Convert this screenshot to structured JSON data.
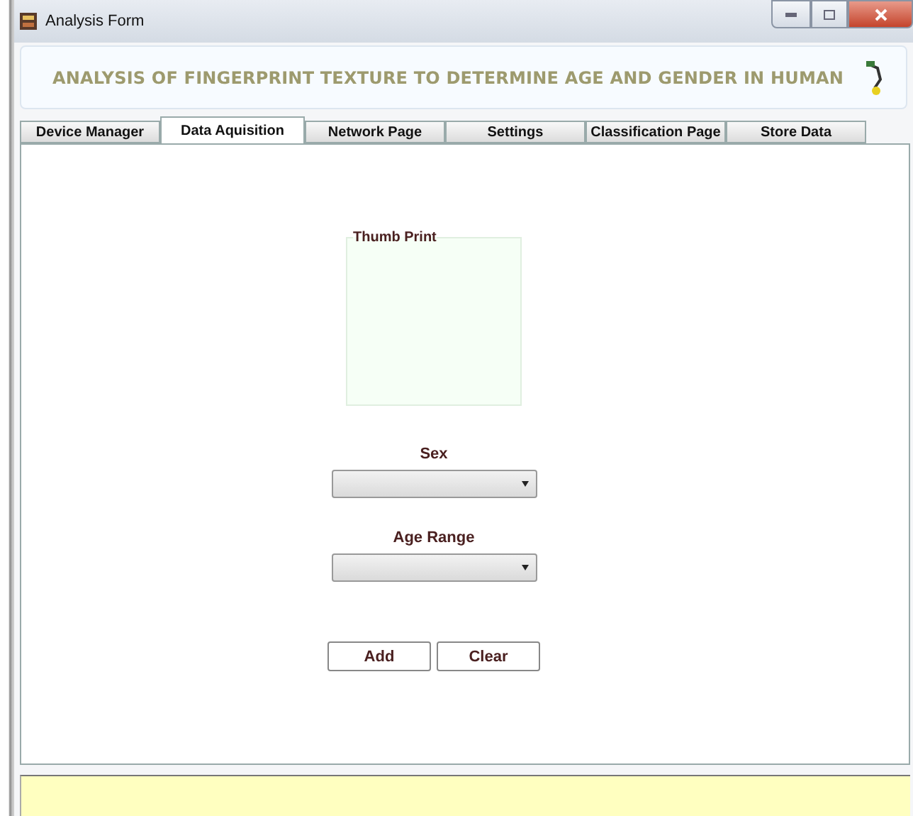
{
  "window": {
    "title": "Analysis Form"
  },
  "banner": {
    "title": "ANALYSIS OF FINGERPRINT TEXTURE TO DETERMINE AGE AND GENDER IN HUMAN"
  },
  "tabs": [
    {
      "label": "Device Manager",
      "selected": false
    },
    {
      "label": "Data Aquisition",
      "selected": true
    },
    {
      "label": "Network Page",
      "selected": false
    },
    {
      "label": "Settings",
      "selected": false
    },
    {
      "label": "Classification Page",
      "selected": false
    },
    {
      "label": "Store Data",
      "selected": false
    }
  ],
  "thumb_print": {
    "title": "Thumb Print"
  },
  "fields": [
    {
      "label": "Sex"
    },
    {
      "label": "Age Range"
    }
  ],
  "buttons": [
    "Add",
    "Clear"
  ]
}
